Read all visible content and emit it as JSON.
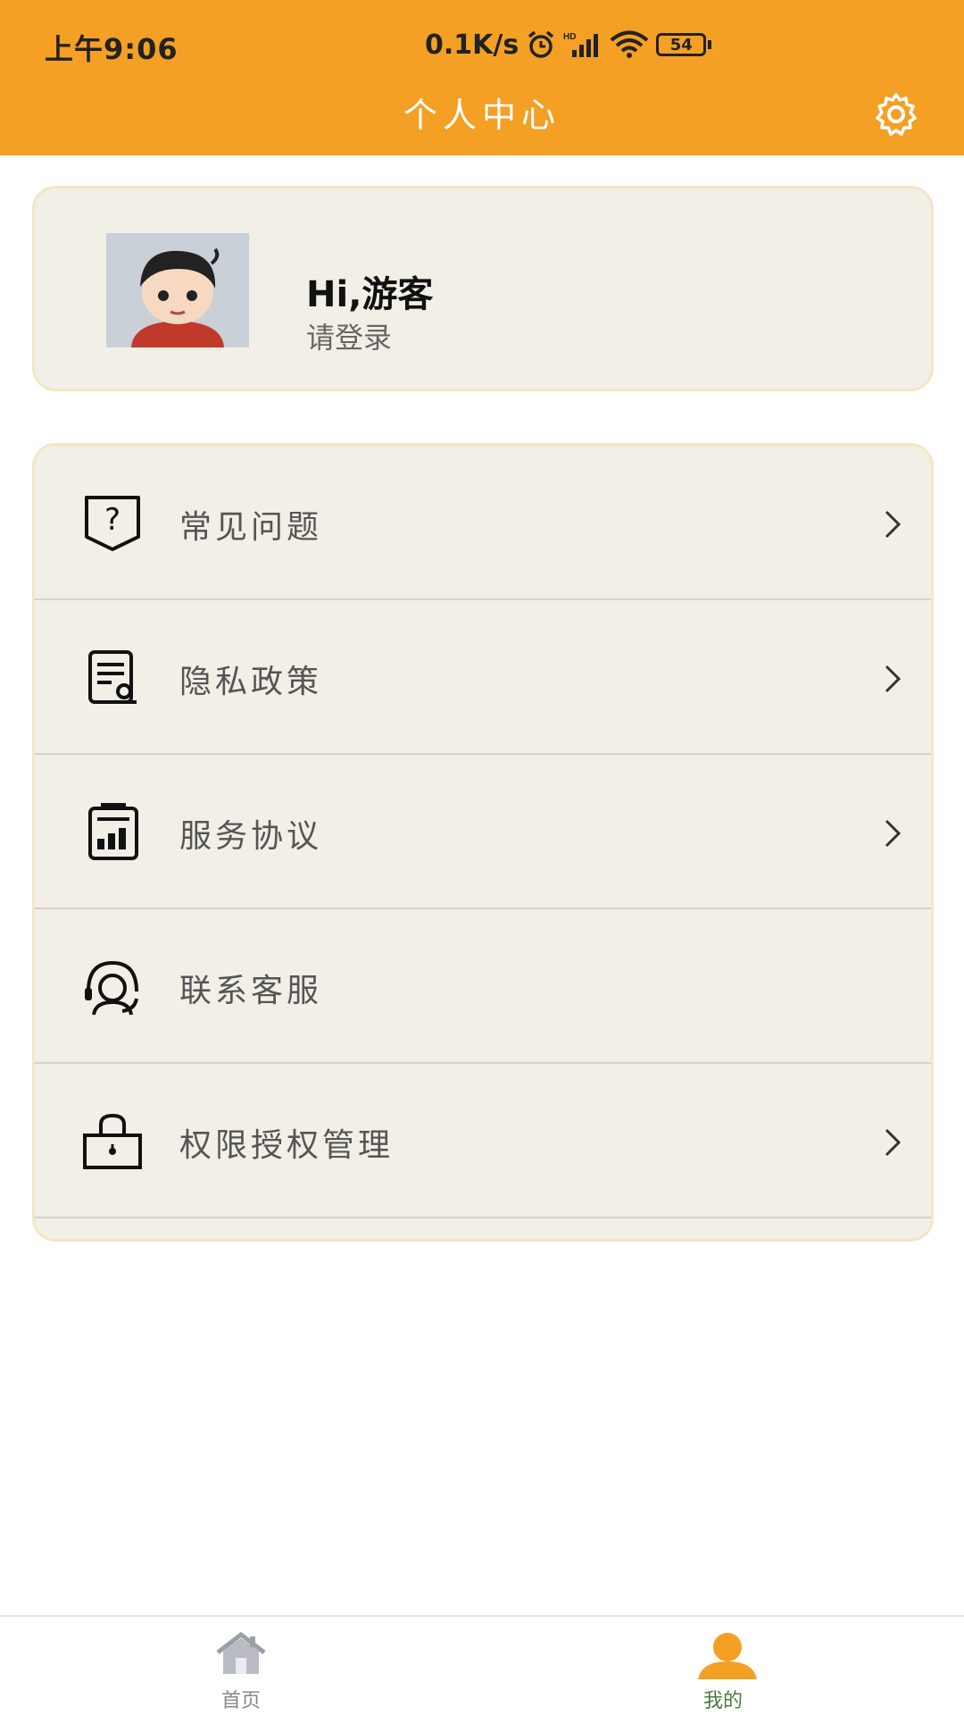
{
  "status_bar": {
    "time": "上午9:06",
    "network_speed": "0.1K/s",
    "battery": "54",
    "icons": [
      "alarm-icon",
      "hd-signal-icon",
      "wifi-icon",
      "battery-icon"
    ]
  },
  "header": {
    "title": "个人中心",
    "settings_icon": "gear-icon"
  },
  "profile": {
    "greeting": "Hi,游客",
    "subtitle": "请登录"
  },
  "menu": {
    "items": [
      {
        "label": "常见问题",
        "icon": "question-shield-icon",
        "has_chevron": true
      },
      {
        "label": "隐私政策",
        "icon": "privacy-document-icon",
        "has_chevron": true
      },
      {
        "label": "服务协议",
        "icon": "agreement-document-icon",
        "has_chevron": true
      },
      {
        "label": "联系客服",
        "icon": "customer-service-icon",
        "has_chevron": false
      },
      {
        "label": "权限授权管理",
        "icon": "lock-icon",
        "has_chevron": true
      }
    ]
  },
  "tabbar": {
    "items": [
      {
        "label": "首页",
        "icon": "home-icon",
        "active": false
      },
      {
        "label": "我的",
        "icon": "user-icon",
        "active": true
      }
    ]
  },
  "colors": {
    "accent": "#F4A024",
    "card_bg": "#F2EFE6",
    "card_border": "#F2E6C4",
    "active_tab_label": "#4a7c3a"
  }
}
